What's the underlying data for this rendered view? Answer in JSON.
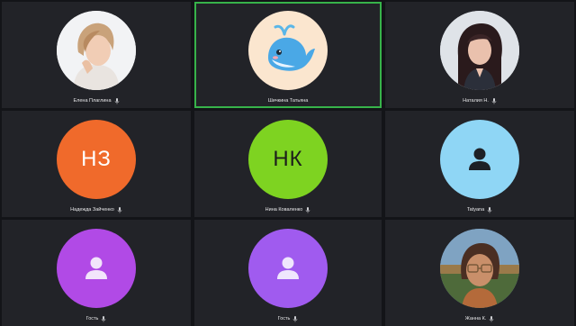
{
  "participants": [
    {
      "name": "Елена Плаглина",
      "avatar": "photo",
      "icon": "person-photo-woman-blonde",
      "active": false
    },
    {
      "name": "Шичкина Татьяна",
      "avatar": "emoji",
      "icon": "whale-icon",
      "bg": "#fbe6cf",
      "active": true
    },
    {
      "name": "Наталия Н.",
      "avatar": "photo",
      "icon": "person-photo-woman-dark-hair",
      "active": false
    },
    {
      "name": "Надежда Зайченко",
      "initials": "НЗ",
      "bg": "#f06a2b",
      "active": false
    },
    {
      "name": "Нина Коваленко",
      "initials": "НК",
      "bg": "#7ed321",
      "active": false
    },
    {
      "name": "Tatyana",
      "avatar": "placeholder",
      "icon": "user-silhouette-icon",
      "bg": "#8fd6f5",
      "active": false
    },
    {
      "name": "Гость",
      "avatar": "placeholder",
      "icon": "user-silhouette-icon",
      "bg": "#b14ae6",
      "active": false
    },
    {
      "name": "Гость",
      "avatar": "placeholder",
      "icon": "user-silhouette-icon",
      "bg": "#a05bef",
      "active": false
    },
    {
      "name": "Жанна К.",
      "avatar": "photo",
      "icon": "person-photo-woman-glasses",
      "active": false
    }
  ],
  "colors": {
    "background": "#131418",
    "tile": "#222328",
    "active_border": "#37b34a"
  }
}
